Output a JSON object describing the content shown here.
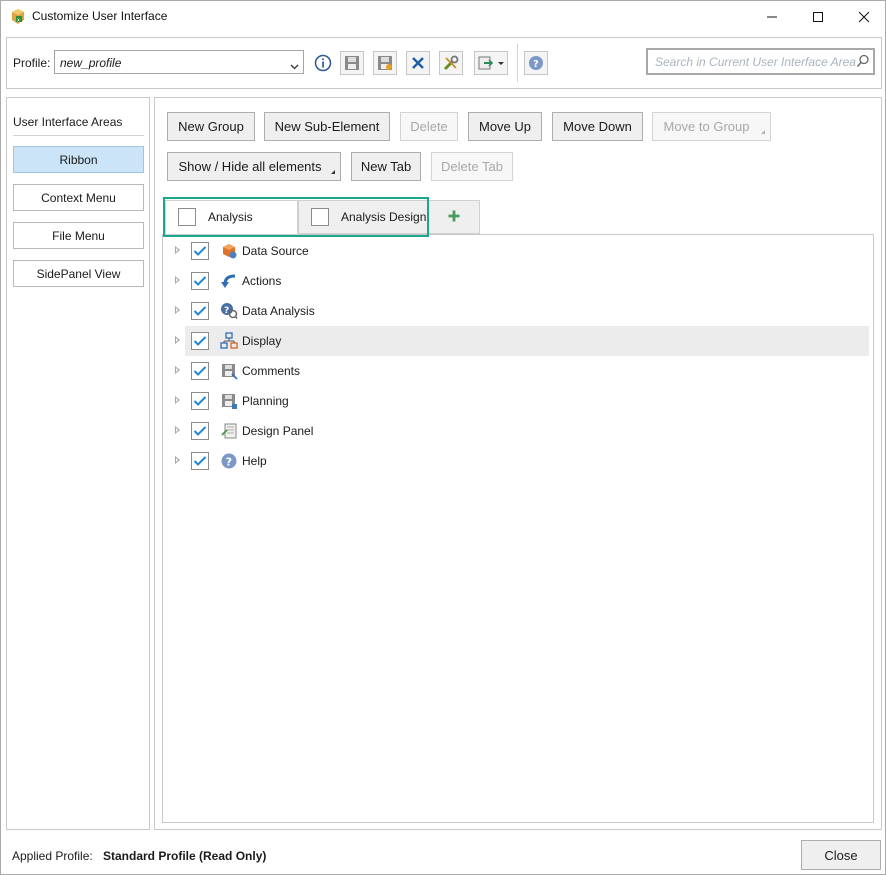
{
  "window": {
    "title": "Customize User Interface",
    "app_icon": "customize-ui-icon",
    "controls": [
      "minimize-icon",
      "maximize-icon",
      "close-icon"
    ]
  },
  "toolbar": {
    "profile_label": "Profile:",
    "profile_value": "new_profile",
    "icons": [
      "info-icon",
      "save-icon",
      "save-as-icon",
      "delete-icon",
      "tools-icon",
      "import-export-icon",
      "help-icon"
    ],
    "search_placeholder": "Search in Current User Interface Area"
  },
  "left_panel": {
    "title": "User Interface Areas",
    "areas": [
      {
        "label": "Ribbon",
        "active": true
      },
      {
        "label": "Context Menu",
        "active": false
      },
      {
        "label": "File Menu",
        "active": false
      },
      {
        "label": "SidePanel View",
        "active": false
      }
    ]
  },
  "actions": {
    "new_group": "New Group",
    "new_sub_element": "New Sub-Element",
    "delete": "Delete",
    "move_up": "Move Up",
    "move_down": "Move Down",
    "move_to_group": "Move to Group",
    "show_hide": "Show / Hide all elements",
    "new_tab": "New Tab",
    "delete_tab": "Delete Tab"
  },
  "tabs": [
    {
      "label": "Analysis",
      "checked": false,
      "selected": true
    },
    {
      "label": "Analysis Design",
      "checked": false,
      "selected": false
    },
    {
      "label": "+",
      "icon": "add-tab-icon"
    }
  ],
  "tree": [
    {
      "label": "Data Source",
      "checked": true,
      "icon": "data-source-icon"
    },
    {
      "label": "Actions",
      "checked": true,
      "icon": "actions-icon"
    },
    {
      "label": "Data Analysis",
      "checked": true,
      "icon": "data-analysis-icon"
    },
    {
      "label": "Display",
      "checked": true,
      "icon": "display-icon",
      "hover": true
    },
    {
      "label": "Comments",
      "checked": true,
      "icon": "comments-icon"
    },
    {
      "label": "Planning",
      "checked": true,
      "icon": "planning-icon"
    },
    {
      "label": "Design Panel",
      "checked": true,
      "icon": "design-panel-icon"
    },
    {
      "label": "Help",
      "checked": true,
      "icon": "help-icon"
    }
  ],
  "footer": {
    "applied_label": "Applied Profile:",
    "applied_value": "Standard Profile (Read Only)",
    "close_label": "Close"
  },
  "colors": {
    "accent_teal": "#1aa68f",
    "selected_area": "#cce4f7",
    "check_blue": "#1f86d4"
  }
}
